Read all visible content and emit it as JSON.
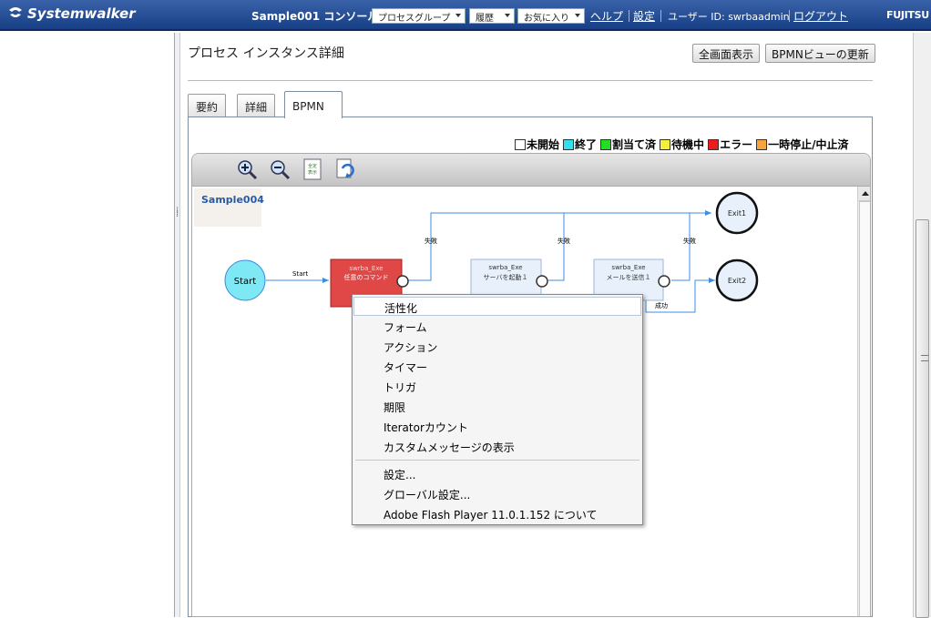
{
  "header": {
    "brand": "Systemwalker",
    "console_title": "Sample001 コンソール",
    "process_group_menu": "プロセスグループ",
    "history_menu": "履歴",
    "favorites_menu": "お気に入り",
    "help_link": "ヘルプ",
    "settings_link": "設定",
    "user_label": "ユーザー ID: swrbaadmin",
    "logout_link": "ログアウト",
    "vendor": "FUJITSU"
  },
  "main": {
    "page_title": "プロセス インスタンス詳細",
    "fullscreen_button": "全画面表示",
    "refresh_button": "BPMNビューの更新",
    "tabs": [
      {
        "label": "要約"
      },
      {
        "label": "詳細"
      },
      {
        "label": "BPMN"
      }
    ]
  },
  "legend": [
    {
      "label": "未開始",
      "color": "#ffffff"
    },
    {
      "label": "終了",
      "color": "#33e0f0"
    },
    {
      "label": "割当て済",
      "color": "#22dd22"
    },
    {
      "label": "待機中",
      "color": "#f4ef3a"
    },
    {
      "label": "エラー",
      "color": "#ee1c1c"
    },
    {
      "label": "一時停止/中止済",
      "color": "#f7a43d"
    }
  ],
  "toolbar": {
    "icons": [
      "zoom-in-icon",
      "zoom-out-icon",
      "document-icon",
      "export-icon"
    ],
    "doc_icon_text1": "全定",
    "doc_icon_text2": "表示"
  },
  "diagram": {
    "process_name": "Sample004",
    "start_label": "Start",
    "start_edge_label": "Start",
    "exit1_label": "Exit1",
    "exit2_label": "Exit2",
    "task1_type": "swrba_Exe",
    "task1_name": "任意のコマンド",
    "task2_type": "swrba_Exe",
    "task2_name": "サーバを起動１",
    "task3_type": "swrba_Exe",
    "task3_name": "メールを送信１",
    "fail_label_1": "失敗",
    "fail_label_2": "失敗",
    "fail_label_3": "失敗",
    "success_label": "成功",
    "colors": {
      "error": "#e04848",
      "finished": "#7ee8f4",
      "not_started": "#e8f1fb",
      "line": "#3d8ee0"
    }
  },
  "context_menu": {
    "items": [
      {
        "label": "活性化"
      },
      {
        "label": "フォーム"
      },
      {
        "label": "アクション"
      },
      {
        "label": "タイマー"
      },
      {
        "label": "トリガ"
      },
      {
        "label": "期限"
      },
      {
        "label": "Iteratorカウント"
      },
      {
        "label": "カスタムメッセージの表示"
      },
      {
        "label": "設定..."
      },
      {
        "label": "グローバル設定..."
      },
      {
        "label": "Adobe Flash Player 11.0.1.152  について"
      }
    ]
  }
}
